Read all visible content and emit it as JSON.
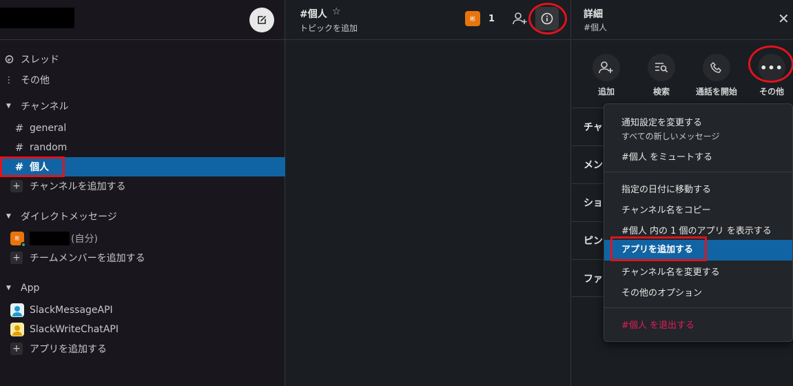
{
  "sidebar": {
    "threads": "スレッド",
    "more": "その他",
    "channels_header": "チャンネル",
    "channels": [
      "general",
      "random",
      "個人"
    ],
    "add_channel": "チャンネルを追加する",
    "dm_header": "ダイレクトメッセージ",
    "dm_self_suffix": "(自分)",
    "add_teammate": "チームメンバーを追加する",
    "app_header": "App",
    "apps": [
      "SlackMessageAPI",
      "SlackWriteChatAPI"
    ],
    "add_app": "アプリを追加する"
  },
  "channel": {
    "name": "#個人",
    "topic_placeholder": "トピックを追加",
    "member_count": "1",
    "avatar_glyph": "彬"
  },
  "details": {
    "title": "詳細",
    "subtitle": "#個人",
    "actions": [
      "追加",
      "検索",
      "通話を開始",
      "その他"
    ],
    "sections": [
      "チャ",
      "メン",
      "ショ",
      "ピン",
      "ファ"
    ]
  },
  "menu": {
    "notification_settings": "通知設定を変更する",
    "notification_current": "すべての新しいメッセージ",
    "mute": "#個人 をミュートする",
    "jump_to_date": "指定の日付に移動する",
    "copy_name": "チャンネル名をコピー",
    "show_apps": "#個人 内の 1 個のアプリ を表示する",
    "add_apps": "アプリを追加する",
    "rename": "チャンネル名を変更する",
    "other_options": "その他のオプション",
    "leave": "#個人 を退出する"
  },
  "colors": {
    "active": "#1164a3",
    "annotation": "#e0131d",
    "danger": "#e01e5a",
    "avatar": "#e8740c"
  }
}
